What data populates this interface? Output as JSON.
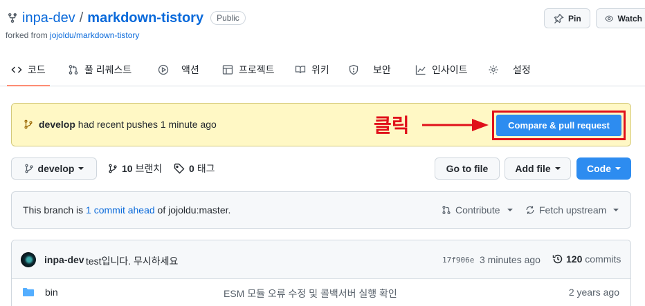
{
  "repo": {
    "owner": "inpa-dev",
    "separator": "/",
    "name": "markdown-tistory",
    "visibility": "Public",
    "forked_prefix": "forked from ",
    "forked_source": "jojoldu/markdown-tistory"
  },
  "header_actions": {
    "pin": "Pin",
    "watch": "Watch"
  },
  "tabs": [
    {
      "label": "코드",
      "icon": "code-icon",
      "active": true
    },
    {
      "label": "풀 리퀘스트",
      "icon": "pull-request-icon"
    },
    {
      "label": "액션",
      "icon": "play-icon"
    },
    {
      "label": "프로젝트",
      "icon": "table-icon"
    },
    {
      "label": "위키",
      "icon": "book-icon"
    },
    {
      "label": "보안",
      "icon": "shield-icon"
    },
    {
      "label": "인사이트",
      "icon": "graph-icon"
    },
    {
      "label": "설정",
      "icon": "gear-icon"
    }
  ],
  "push_banner": {
    "branch": "develop",
    "message": "had recent pushes 1 minute ago",
    "annotation": "클릭",
    "button": "Compare & pull request",
    "highlight_color": "#e0101a"
  },
  "toolbar": {
    "branch": "develop",
    "branches_count": "10",
    "branches_label": "브랜치",
    "tags_count": "0",
    "tags_label": "태그",
    "go_to_file": "Go to file",
    "add_file": "Add file",
    "code": "Code"
  },
  "branch_info": {
    "prefix": "This branch is ",
    "link": "1 commit ahead",
    "suffix": " of jojoldu:master.",
    "contribute": "Contribute",
    "fetch_upstream": "Fetch upstream"
  },
  "latest_commit": {
    "user": "inpa-dev",
    "message": "test입니다. 무시하세요",
    "sha": "17f906e",
    "time": "3 minutes ago",
    "count": "120",
    "count_label": "commits"
  },
  "files": [
    {
      "name": "bin",
      "message": "ESM 모듈 오류 수정 및 콜백서버 실행 확인",
      "age": "2 years ago"
    }
  ],
  "colors": {
    "accent": "#0969da",
    "compare_button": "#2d8cf0",
    "banner_bg": "#fff8c5",
    "active_tab_underline": "#fd8c73"
  }
}
